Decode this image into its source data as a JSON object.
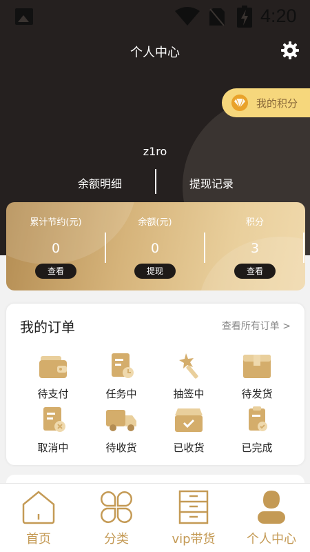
{
  "status_bar": {
    "time": "4:20"
  },
  "header": {
    "title": "个人中心",
    "points_label": "我的积分"
  },
  "user": {
    "name": "z1ro",
    "link_balance": "余额明细",
    "link_withdraw": "提现记录"
  },
  "stats": [
    {
      "title": "累计节约(元)",
      "value": "0",
      "button": "查看"
    },
    {
      "title": "余额(元)",
      "value": "0",
      "button": "提现"
    },
    {
      "title": "积分",
      "value": "3",
      "button": "查看"
    }
  ],
  "orders": {
    "title": "我的订单",
    "view_all": "查看所有订单 >",
    "items": [
      {
        "label": "待支付",
        "icon": "wallet-icon"
      },
      {
        "label": "任务中",
        "icon": "document-clock-icon"
      },
      {
        "label": "抽签中",
        "icon": "magic-wand-icon"
      },
      {
        "label": "待发货",
        "icon": "box-icon"
      },
      {
        "label": "取消中",
        "icon": "document-cancel-icon"
      },
      {
        "label": "待收货",
        "icon": "truck-icon"
      },
      {
        "label": "已收货",
        "icon": "box-check-icon"
      },
      {
        "label": "已完成",
        "icon": "clipboard-check-icon"
      }
    ]
  },
  "nav": [
    {
      "label": "首页",
      "icon": "home-icon"
    },
    {
      "label": "分类",
      "icon": "category-icon"
    },
    {
      "label": "vip带货",
      "icon": "cabinet-icon"
    },
    {
      "label": "个人中心",
      "icon": "user-icon"
    }
  ],
  "colors": {
    "dark": "#25201f",
    "gold": "#c49a55",
    "pill": "#f6d77c"
  }
}
